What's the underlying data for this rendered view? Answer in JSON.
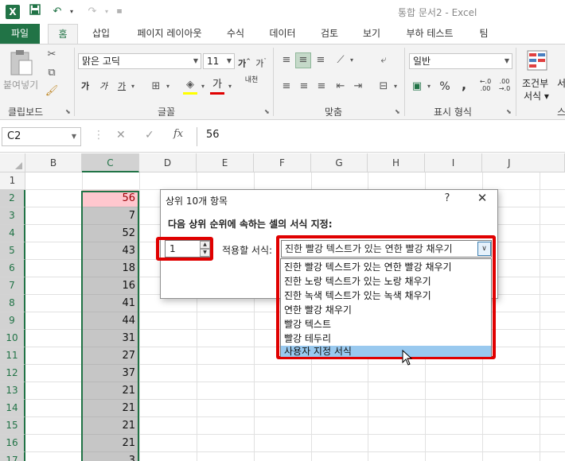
{
  "app": {
    "logo_letter": "X",
    "window_title": "통합 문서2 - Excel"
  },
  "quick_access": {
    "save_icon": "save-icon",
    "undo_icon": "undo-icon",
    "redo_icon": "redo-icon",
    "customize_icon": "customize-icon"
  },
  "tabs": [
    "파일",
    "홈",
    "삽입",
    "페이지 레이아웃",
    "수식",
    "데이터",
    "검토",
    "보기",
    "부하 테스트",
    "팀"
  ],
  "ribbon": {
    "clipboard": {
      "paste_label": "붙여넣기",
      "group_label": "클립보드"
    },
    "font": {
      "font_name": "맑은 고딕",
      "font_size": "11",
      "group_label": "글꼴",
      "phonetic": "내천"
    },
    "alignment": {
      "group_label": "맞춤"
    },
    "number": {
      "format": "일반",
      "group_label": "표시 형식",
      "percent": "%",
      "comma": ","
    },
    "styles": {
      "conditional_label_1": "조건부",
      "conditional_label_2": "서식",
      "partial_label_1": "서",
      "partial_label_2": "스"
    }
  },
  "formula_bar": {
    "name_box": "C2",
    "fx": "fx",
    "value": "56"
  },
  "grid": {
    "columns": [
      "B",
      "C",
      "D",
      "E",
      "F",
      "G",
      "H",
      "I",
      "J"
    ],
    "selected_column": "C",
    "rows": [
      "1",
      "2",
      "3",
      "4",
      "5",
      "6",
      "7",
      "8",
      "9",
      "10",
      "11",
      "12",
      "13",
      "14",
      "15",
      "16",
      "17"
    ],
    "c_values": [
      "",
      "56",
      "7",
      "52",
      "43",
      "18",
      "16",
      "41",
      "44",
      "31",
      "27",
      "37",
      "21",
      "21",
      "21",
      "21",
      "3"
    ],
    "highlight_color": "#ffc7ce",
    "highlight_text_color": "#9c0006"
  },
  "dialog": {
    "title": "상위 10개 항목",
    "help": "?",
    "close": "✕",
    "prompt": "다음 상위 순위에 속하는 셀의 서식 지정:",
    "rank_value": "1",
    "format_label": "적용할 서식:",
    "format_selected": "진한 빨강 텍스트가 있는 연한 빨강 채우기",
    "options": [
      "진한 빨강 텍스트가 있는 연한 빨강 채우기",
      "진한 노랑 텍스트가 있는 노랑 채우기",
      "진한 녹색 텍스트가 있는 녹색 채우기",
      "연한 빨강 채우기",
      "빨강 텍스트",
      "빨강 테두리",
      "사용자 지정 서식"
    ],
    "highlighted_option_index": 6,
    "annotation_color": "#e00000"
  }
}
